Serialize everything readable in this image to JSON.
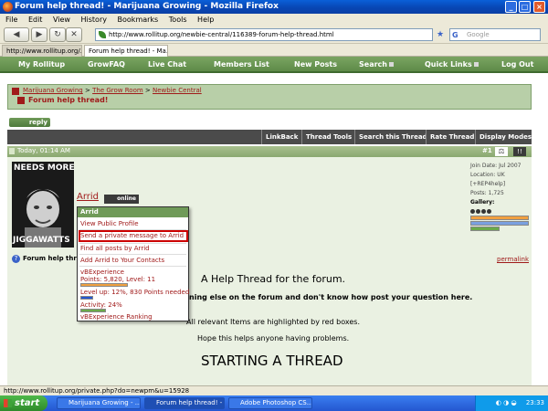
{
  "window": {
    "title": "Forum help thread! - Marijuana Growing - Mozilla Firefox",
    "minimize": "_",
    "maximize": "□",
    "close": "×"
  },
  "menu": [
    "File",
    "Edit",
    "View",
    "History",
    "Bookmarks",
    "Tools",
    "Help"
  ],
  "toolbar": {
    "back_icon": "arrow-left",
    "forward_icon": "arrow-right",
    "reload_icon": "reload",
    "stop_icon": "stop",
    "home_icon": "home",
    "url": "http://www.rollitup.org/newbie-central/116389-forum-help-thread.html",
    "search_placeholder": "Google"
  },
  "tabs": [
    {
      "label": "http://www.rollitup.org/...",
      "active": false
    },
    {
      "label": "Forum help thread! - Ma...",
      "active": true
    }
  ],
  "site_nav": [
    "My Rollitup",
    "GrowFAQ",
    "Live Chat",
    "Members List",
    "New Posts",
    "Search",
    "Quick Links",
    "Log Out"
  ],
  "breadcrumb": {
    "items": [
      "Marijuana Growing",
      "The Grow Room",
      "Newbie Central"
    ],
    "separator": ">",
    "title": "Forum help thread!"
  },
  "reply_label": "reply",
  "thread_tools": [
    "LinkBack",
    "Thread Tools",
    "Search this Thread",
    "Rate Thread",
    "Display Modes"
  ],
  "post": {
    "date": "Today, 01:14 AM",
    "number": "#1",
    "username": "Arrid",
    "status": "online",
    "avatar_top": "NEEDS MORE",
    "avatar_bottom": "JIGGAWATTS",
    "join_date": "Join Date: Jul 2007",
    "location": "Location: UK [+REP4help]",
    "posts": "Posts: 1,725",
    "gallery": "Gallery:",
    "title_text": "Forum help thread!",
    "permalink": "permalink",
    "body": {
      "heading": "A Help Thread for the forum.",
      "line1": "ning else on the forum and don't know how post your question here.",
      "line2": "All relevant Items are highlighted by red boxes.",
      "line3": "Hope this helps anyone having problems.",
      "big": "STARTING A THREAD"
    }
  },
  "dropdown": {
    "header": "Arrid",
    "items": [
      "View Public Profile",
      "Send a private message to Arrid",
      "Find all posts by Arrid",
      "Add Arrid to Your Contacts"
    ],
    "vb_title": "vBExperience",
    "points": "Points: 5,820, Level: 11",
    "levelup": "Level up: 12%, 830 Points needed",
    "activity": "Activity: 24%",
    "ranking": "vBExperience Ranking",
    "points_fill": 0.45,
    "levelup_fill": 0.12,
    "activity_fill": 0.24
  },
  "status_text": "http://www.rollitup.org/private.php?do=newpm&u=15928",
  "taskbar": {
    "start": "start",
    "tasks": [
      {
        "label": "Marijuana Growing - ...",
        "active": false
      },
      {
        "label": "Forum help thread! - ...",
        "active": true
      },
      {
        "label": "Adobe Photoshop CS...",
        "active": false
      }
    ],
    "clock": "23:33"
  },
  "colors": {
    "nav_green": "#5e8a48",
    "highlight_red": "#cc0000",
    "link_red": "#a01a1a",
    "xp_blue": "#2457d0"
  }
}
